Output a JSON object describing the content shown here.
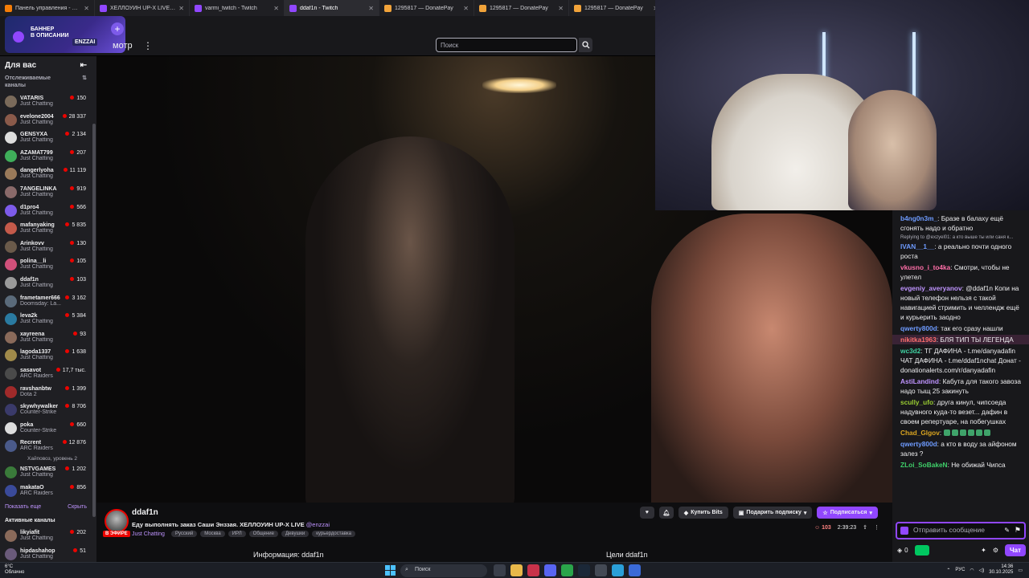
{
  "tabs": [
    {
      "title": "Панель управления - Donation...",
      "icon": "donationalerts-icon",
      "active": false
    },
    {
      "title": "ХЕЛЛОУИН UP-X LIVE - Twitch",
      "icon": "twitch-icon",
      "active": false
    },
    {
      "title": "varmi_twitch - Twitch",
      "icon": "twitch-icon",
      "active": false
    },
    {
      "title": "ddaf1n - Twitch",
      "icon": "twitch-icon",
      "active": true
    },
    {
      "title": "1295817 — DonatePay",
      "icon": "donatepay-icon",
      "active": false
    },
    {
      "title": "1295817 — DonatePay",
      "icon": "donatepay-icon",
      "active": false
    },
    {
      "title": "1295817 — DonatePay",
      "icon": "donatepay-icon",
      "active": false
    }
  ],
  "banner": {
    "line1": "БАННЕР",
    "line2": "В ОПИСАНИИ",
    "tag": "ENZZAI"
  },
  "nav": {
    "browse": "мотр",
    "search_placeholder": "Поиск"
  },
  "sidebar": {
    "title": "Для вас",
    "followed_heading": "Отслеживаемые каналы",
    "channels": [
      {
        "name": "VATARIS",
        "game": "Just Chatting",
        "viewers": "150",
        "color": "#7a6a5a"
      },
      {
        "name": "evelone2004",
        "game": "Just Chatting",
        "viewers": "28 337",
        "color": "#8a5a4a"
      },
      {
        "name": "GENSYXA",
        "game": "Just Chatting",
        "viewers": "2 134",
        "color": "#dddddd"
      },
      {
        "name": "AZAMAT799",
        "game": "Just Chatting",
        "viewers": "207",
        "color": "#3fae5a"
      },
      {
        "name": "dangerlyoha",
        "game": "Just Chatting",
        "viewers": "11 119",
        "color": "#9a7a5a"
      },
      {
        "name": "7ANGELINKA",
        "game": "Just Chatting",
        "viewers": "919",
        "color": "#8a6a6a"
      },
      {
        "name": "d1pro4",
        "game": "Just Chatting",
        "viewers": "566",
        "color": "#7d5bea"
      },
      {
        "name": "mafanyaking",
        "game": "Just Chatting",
        "viewers": "5 835",
        "color": "#c45a4a"
      },
      {
        "name": "Arinkovv",
        "game": "Just Chatting",
        "viewers": "130",
        "color": "#6a5a4a"
      },
      {
        "name": "polina__li",
        "game": "Just Chatting",
        "viewers": "105",
        "color": "#d0507a"
      },
      {
        "name": "ddaf1n",
        "game": "Just Chatting",
        "viewers": "103",
        "color": "#9a9a9a"
      },
      {
        "name": "frametamer666",
        "game": "Doomsday: La...",
        "viewers": "3 162",
        "color": "#5a6a7a"
      },
      {
        "name": "leva2k",
        "game": "Just Chatting",
        "viewers": "5 384",
        "color": "#2a7aa0"
      },
      {
        "name": "xayreena",
        "game": "Just Chatting",
        "viewers": "93",
        "color": "#8a6a5a"
      },
      {
        "name": "lagoda1337",
        "game": "Just Chatting",
        "viewers": "1 638",
        "color": "#a08a4a"
      },
      {
        "name": "sasavot",
        "game": "ARC Raiders",
        "viewers": "17,7 тыс.",
        "color": "#4a4a4a"
      },
      {
        "name": "ravshanbtw",
        "game": "Dota 2",
        "viewers": "1 399",
        "color": "#a02a2a"
      },
      {
        "name": "skywhywalker",
        "game": "Counter-Strike",
        "viewers": "8 706",
        "color": "#3a3a6a"
      },
      {
        "name": "poka",
        "game": "Counter-Strike",
        "viewers": "660",
        "color": "#dddddd"
      },
      {
        "name": "Recrent",
        "game": "ARC Raiders",
        "viewers": "12 876",
        "color": "#4a5a8a",
        "extra": "Хайповоз, уровень 2"
      },
      {
        "name": "NSTVGAMES",
        "game": "Just Chatting",
        "viewers": "1 202",
        "color": "#3a7a3a"
      },
      {
        "name": "makataO",
        "game": "ARC Raiders",
        "viewers": "856",
        "color": "#3a4a9a"
      }
    ],
    "show_more": "Показать еще",
    "hide": "Скрыть",
    "active_heading": "Активные каналы",
    "active_channels": [
      {
        "name": "likyiafit",
        "game": "Just Chatting",
        "viewers": "202",
        "color": "#8a6a5a"
      },
      {
        "name": "hipdashahop",
        "game": "Just Chatting",
        "viewers": "51",
        "color": "#6a5a7a"
      }
    ]
  },
  "chat": {
    "messages": [
      {
        "user": "b4ng0n3m_",
        "color": "#6e9bff",
        "text": "Бразе в балаху ещё сгонять надо и обратно"
      },
      {
        "reply": "Replying to @exzyel01: а кто выше ты или саня к..."
      },
      {
        "user": "IVAN__1__",
        "color": "#6e9bff",
        "text": "а реально почти одного роста"
      },
      {
        "user": "vkusno_i_to4ka",
        "color": "#ff6fa8",
        "text": "Смотри, чтобы не улетел"
      },
      {
        "user": "evgeniy_averyanov",
        "color": "#bf94ff",
        "text": "@ddaf1n Копи на новый телефон нельзя с такой навигацией стримить и челлендж ещё и курьерить заодно"
      },
      {
        "user": "qwerty800d",
        "color": "#6e9bff",
        "text": "так его сразу нашли"
      },
      {
        "user": "nikitka1963",
        "color": "#ff6f6f",
        "text": "БЛЯ ТИП ТЫ ЛЕГЕНДА",
        "highlight": true
      },
      {
        "user": "wc3d2",
        "color": "#3fd0a0",
        "text": "ТГ ДАФИНА - t.me/danyadafin ЧАТ ДАФИНА - t.me/ddaf1nchat Донат - donationalerts.com/r/danyadafin"
      },
      {
        "user": "AstiLandind",
        "color": "#bf94ff",
        "text": "Кабута для такого завоза надо тыщ 25 закинуть"
      },
      {
        "user": "scully_ufo",
        "color": "#9acd32",
        "text": "друга кинул, чипсоеда надувного куда-то везет... дафин в своем репертуаре, на побегушках"
      },
      {
        "user": "Chad_Glgov",
        "color": "#daa520",
        "text": ""
      },
      {
        "user": "qwerty800d",
        "color": "#6e9bff",
        "text": "а кто в воду за айфоном залез ?"
      },
      {
        "user": "ZLoi_SoBakeN",
        "color": "#3fd06a",
        "text": "Не обижай Чипса"
      }
    ],
    "input_placeholder": "Отправить сообщение",
    "points": "0",
    "chat_button": "Чат"
  },
  "stream": {
    "channel": "ddaf1n",
    "live_badge": "В ЭФИРЕ",
    "title": "Еду выполнять заказ Саши Энззая. ХЕЛЛОУИН UP-X LIVE",
    "title_mention": "@enzzai",
    "category": "Just Chatting",
    "tags": [
      "Русский",
      "Москва",
      "ИРЛ",
      "Общение",
      "Девушки",
      "курьердоставка"
    ],
    "buy_bits": "Купить Bits",
    "gift_sub": "Подарить подписку",
    "subscribe": "Подписаться",
    "viewers": "103",
    "uptime": "2:39:23",
    "about_heading": "Информация: ddaf1n",
    "goals_heading": "Цели ddaf1n"
  },
  "taskbar": {
    "temp": "6°C",
    "weather": "Облачно",
    "search": "Поиск",
    "lang": "РУС",
    "time": "14:36",
    "date": "30.10.2025"
  }
}
